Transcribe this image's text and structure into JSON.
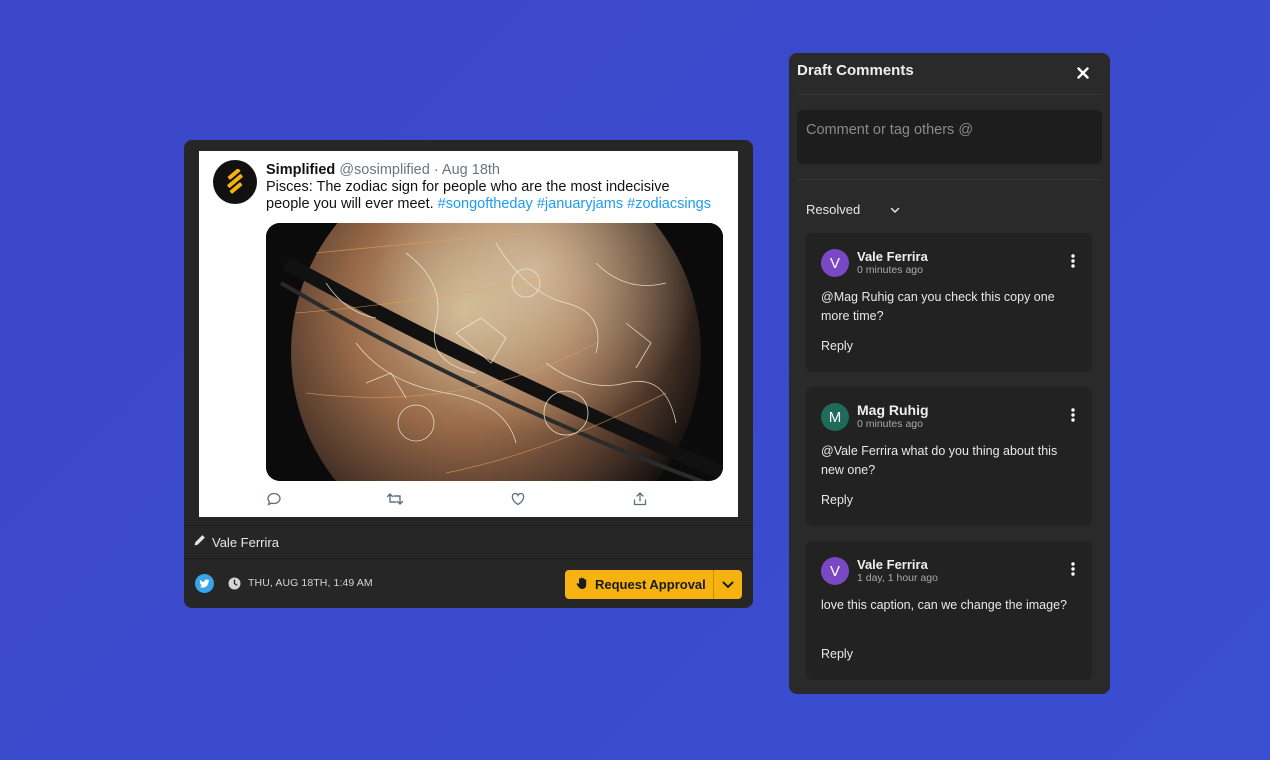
{
  "post": {
    "account_name": "Simplified",
    "handle": "@sosimplified",
    "separator": "·",
    "date": "Aug 18th",
    "text": "Pisces: The zodiac sign for people who are the most indecisive people you will ever meet. ",
    "hashtags": [
      "#songoftheday",
      "#januaryjams",
      "#zodiacsings"
    ],
    "image_icon": "zodiac-globe-photo",
    "actions": [
      "reply-icon",
      "retweet-icon",
      "like-icon",
      "share-icon"
    ]
  },
  "author": {
    "icon": "pencil-icon",
    "name": "Vale Ferrira"
  },
  "footer": {
    "network_icon": "twitter-icon",
    "schedule_icon": "clock-icon",
    "schedule": "THU, AUG 18TH, 1:49 AM",
    "approve_label": "Request Approval",
    "approve_icon": "hand-icon",
    "accent": "#f6b210"
  },
  "comments_panel": {
    "title": "Draft Comments",
    "input_placeholder": "Comment or tag others @",
    "filter": "Resolved",
    "reply_label": "Reply",
    "comments": [
      {
        "initial": "V",
        "avatar_color": "#7b48c5",
        "name": "Vale Ferrira",
        "time": "0 minutes ago",
        "text": "@Mag Ruhig can you check this copy one more time?"
      },
      {
        "initial": "M",
        "avatar_color": "#1f6b5a",
        "name": "Mag Ruhig",
        "time": "0 minutes ago",
        "text": "@Vale Ferrira what do you thing about this new one?"
      },
      {
        "initial": "V",
        "avatar_color": "#7b48c5",
        "name": "Vale Ferrira",
        "time": "1 day, 1 hour ago",
        "text": "love this caption, can we change the image?"
      }
    ]
  }
}
